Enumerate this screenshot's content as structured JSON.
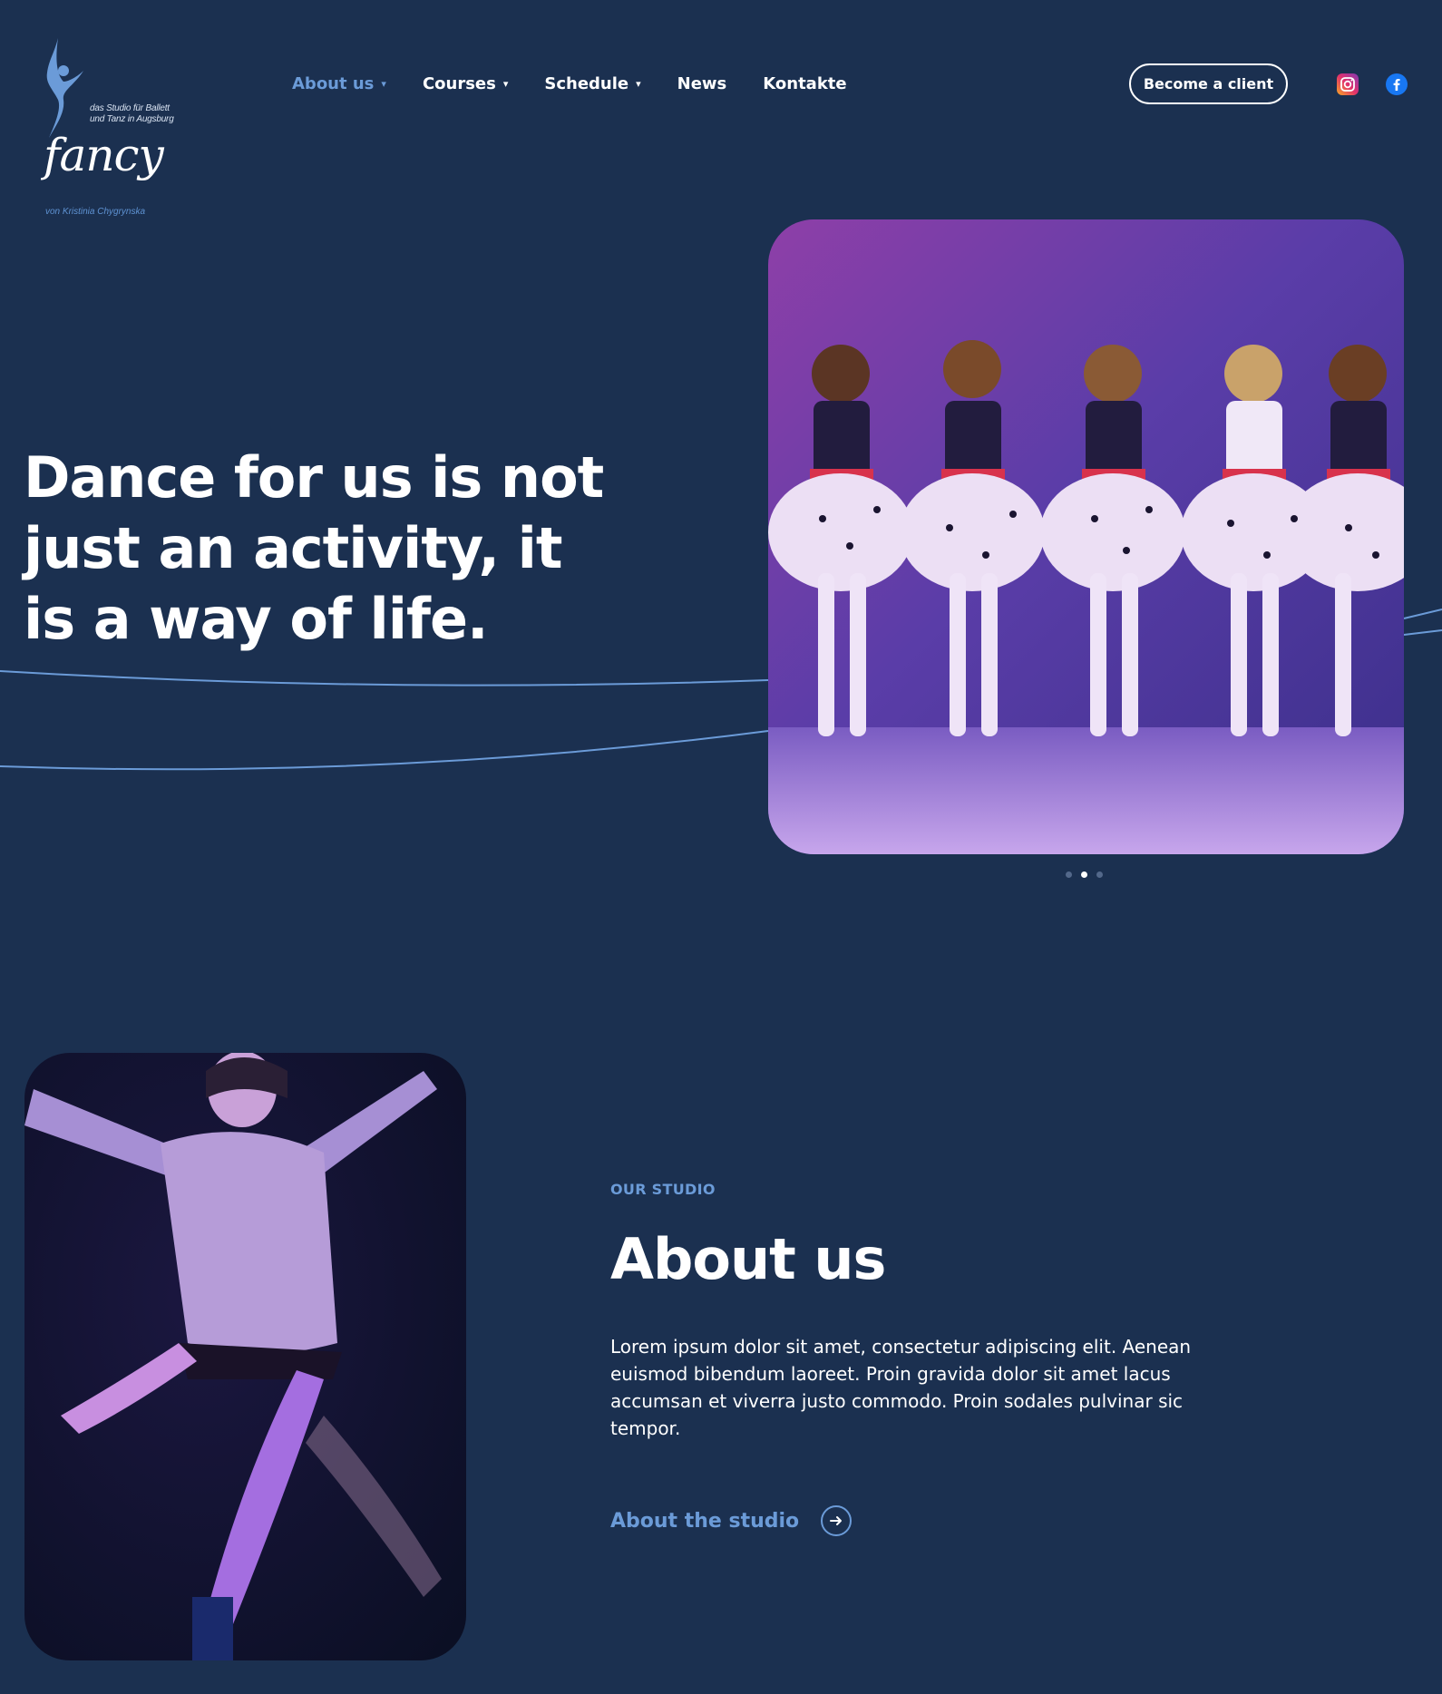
{
  "logo": {
    "tagline_line1": "das Studio für Ballett",
    "tagline_line2": "und Tanz in Augsburg",
    "wordmark": "fancy",
    "author": "von Kristinia Chygrynska"
  },
  "nav": {
    "items": [
      {
        "label": "About us",
        "has_dropdown": true,
        "active": true
      },
      {
        "label": "Courses",
        "has_dropdown": true,
        "active": false
      },
      {
        "label": "Schedule",
        "has_dropdown": true,
        "active": false
      },
      {
        "label": "News",
        "has_dropdown": false,
        "active": false
      },
      {
        "label": "Kontakte",
        "has_dropdown": false,
        "active": false
      }
    ],
    "cta_label": "Become a client",
    "social": [
      "instagram-icon",
      "facebook-icon"
    ]
  },
  "hero": {
    "title": "Dance for us is not just an activity, it is a way of life.",
    "image_alt": "Young dancers in polka-dot costumes on stage",
    "slider_total": 3,
    "slider_active": 2
  },
  "about": {
    "eyebrow": "OUR STUDIO",
    "title": "About us",
    "body": "Lorem ipsum dolor sit amet, consectetur adipiscing elit. Aenean euismod bibendum laoreet. Proin gravida dolor sit amet lacus accumsan et viverra justo commodo. Proin sodales pulvinar sic tempor.",
    "link_label": "About the studio",
    "image_alt": "Dancer leaping on stage"
  },
  "colors": {
    "background": "#1b3050",
    "accent": "#6b9bd8",
    "text": "#ffffff"
  }
}
